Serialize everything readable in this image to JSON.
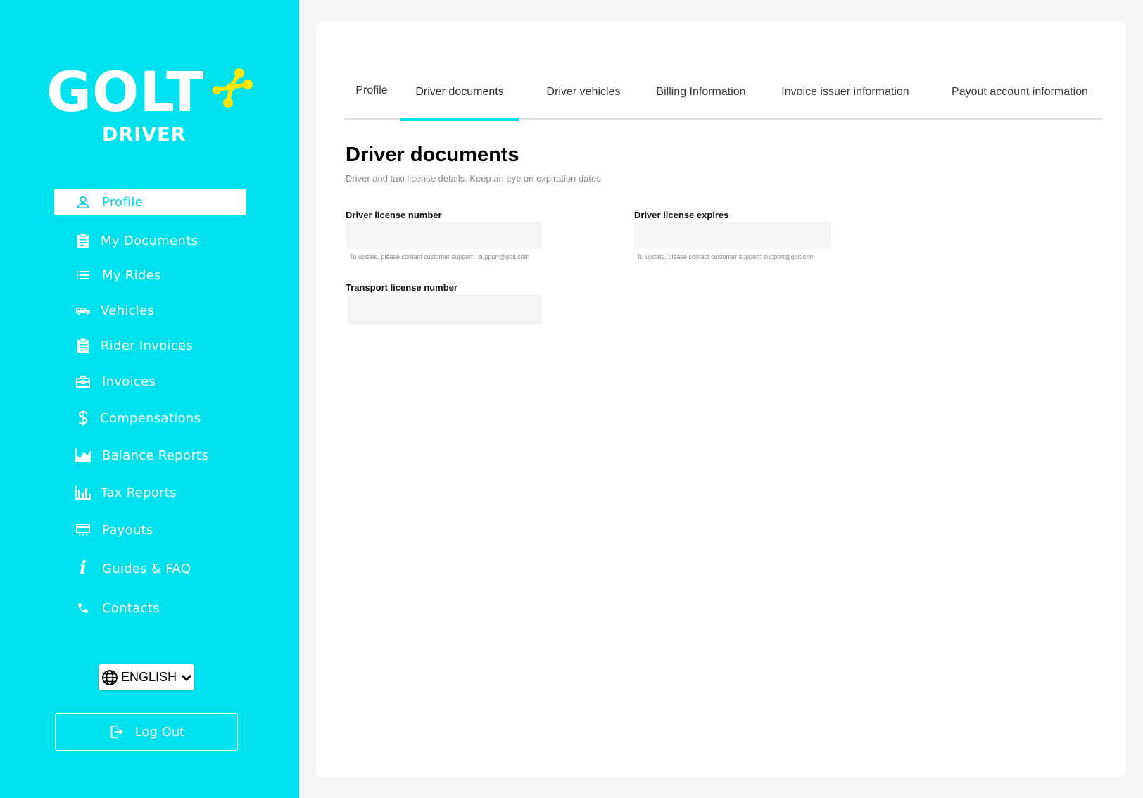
{
  "brand": {
    "name": "GOLT",
    "sub": "DRIVER",
    "colors": {
      "primary": "#00e1ee",
      "accent": "#ffe600"
    }
  },
  "sidebar": {
    "items": [
      {
        "label": "Profile",
        "icon": "person-icon",
        "active": true
      },
      {
        "label": "My Documents",
        "icon": "clipboard-icon"
      },
      {
        "label": "My Rides",
        "icon": "list-icon"
      },
      {
        "label": "Vehicles",
        "icon": "van-icon"
      },
      {
        "label": "Rider Invoices",
        "icon": "clipboard-icon"
      },
      {
        "label": "Invoices",
        "icon": "briefcase-icon"
      },
      {
        "label": "Compensations",
        "icon": "dollar-icon"
      },
      {
        "label": "Balance Reports",
        "icon": "area-chart-icon"
      },
      {
        "label": "Tax Reports",
        "icon": "bar-chart-icon"
      },
      {
        "label": "Payouts",
        "icon": "card-icon"
      },
      {
        "label": "Guides & FAQ",
        "icon": "info-icon"
      },
      {
        "label": "Contacts",
        "icon": "phone-icon"
      }
    ],
    "language": "ENGLISH",
    "logout": "Log Out"
  },
  "tabs": [
    {
      "label": "Profile"
    },
    {
      "label": "Driver documents",
      "active": true
    },
    {
      "label": "Driver vehicles"
    },
    {
      "label": "Billing Information"
    },
    {
      "label": "Invoice issuer information"
    },
    {
      "label": "Payout account information"
    }
  ],
  "section": {
    "title": "Driver documents",
    "subtitle": "Driver and taxi  license details. Keep an eye on expiration dates."
  },
  "fields": {
    "driver_license_number": {
      "label": "Driver license number",
      "value": "",
      "hint": "To update, please contact customer support : support@golt.com"
    },
    "driver_license_expires": {
      "label": "Driver license expires",
      "value": "",
      "hint": "To update, please contact customer support: support@golt.com"
    },
    "transport_license_number": {
      "label": "Transport license number",
      "value": ""
    }
  }
}
